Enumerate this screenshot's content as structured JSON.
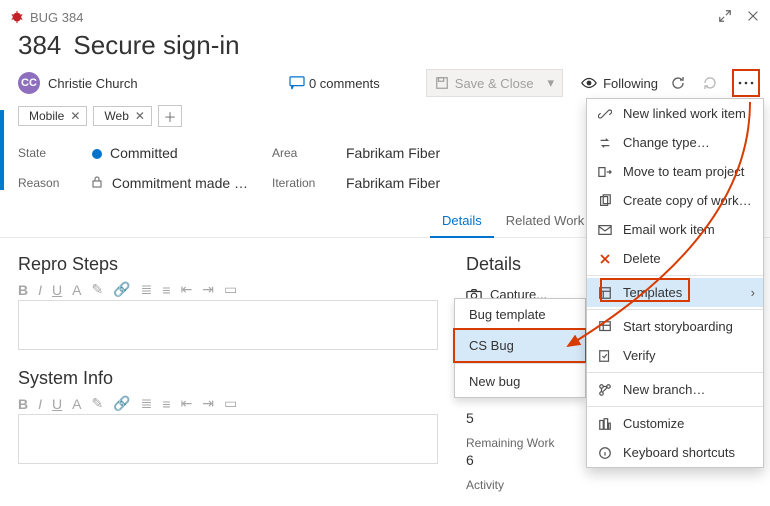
{
  "header": {
    "type_id": "BUG 384",
    "id": "384",
    "title": "Secure sign-in"
  },
  "assignee": {
    "name": "Christie Church",
    "initials": "CC",
    "avatar_bg": "#8e6fbd"
  },
  "comments": {
    "label": "0 comments"
  },
  "actions": {
    "save_close": "Save & Close",
    "following": "Following"
  },
  "tags": [
    "Mobile",
    "Web"
  ],
  "fields": {
    "state_label": "State",
    "state_value": "Committed",
    "reason_label": "Reason",
    "reason_value": "Commitment made …",
    "area_label": "Area",
    "area_value": "Fabrikam Fiber",
    "iteration_label": "Iteration",
    "iteration_value": "Fabrikam Fiber"
  },
  "tabs": {
    "details": "Details",
    "related": "Related Work item"
  },
  "sections": {
    "repro": "Repro Steps",
    "sysinfo": "System Info",
    "details": "Details",
    "capture": "Capture...",
    "remaining_label": "Remaining Work",
    "remaining_num_top": "5",
    "remaining_num": "6",
    "activity_label": "Activity"
  },
  "submenu": {
    "bug_template": "Bug template",
    "cs_bug": "CS Bug",
    "new_bug": "New bug"
  },
  "menu": {
    "new_linked": "New linked work item",
    "change_type": "Change type…",
    "move_team": "Move to team project",
    "create_copy": "Create copy of work item…",
    "email": "Email work item",
    "delete": "Delete",
    "templates": "Templates",
    "storyboard": "Start storyboarding",
    "verify": "Verify",
    "new_branch": "New branch…",
    "customize": "Customize",
    "shortcuts": "Keyboard shortcuts"
  }
}
